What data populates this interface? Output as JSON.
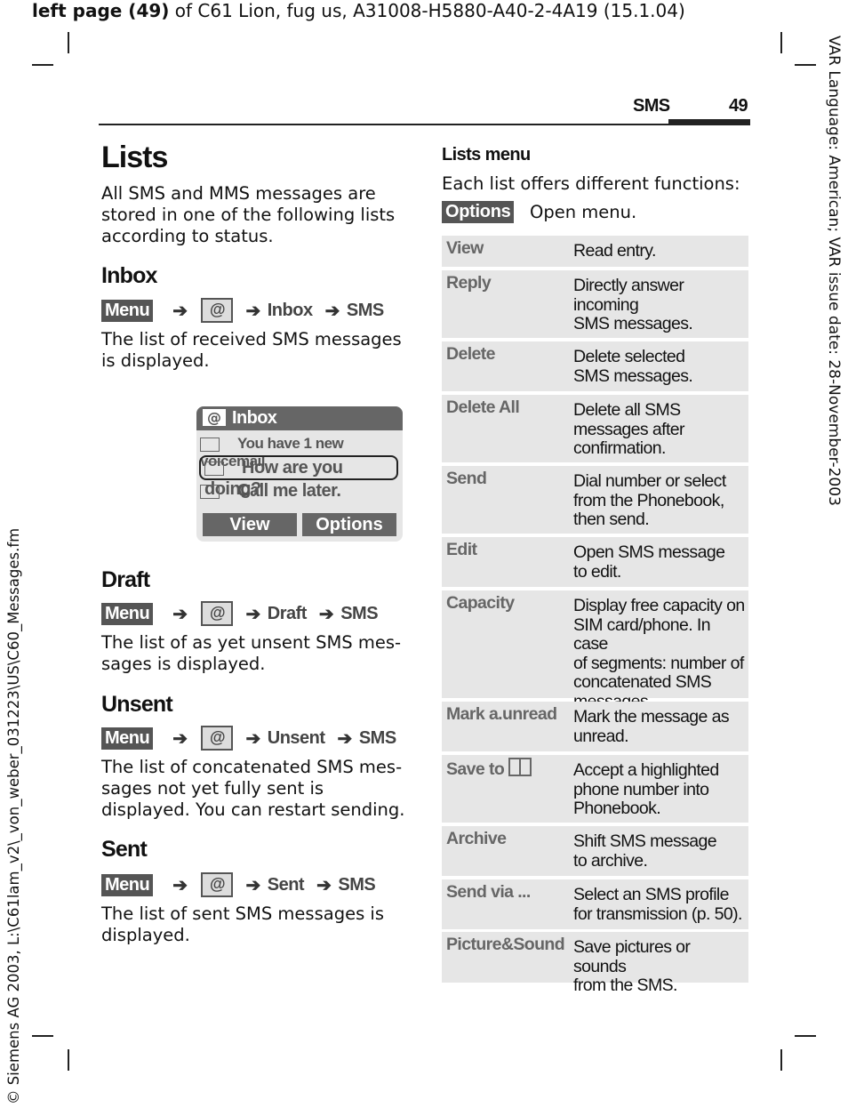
{
  "header": {
    "bold": "left page (49)",
    "rest": " of C61 Lion, fug us, A31008-H5880-A40-2-4A19 (15.1.04)"
  },
  "running_head": {
    "section": "SMS",
    "page": "49"
  },
  "side_right": "VAR Language: American; VAR issue date: 28-November-2003",
  "side_left": "© Siemens AG 2003, L:\\C61lam_v2\\_von_weber_031223\\US\\C60_Messages.fm",
  "title": "Lists",
  "intro": "All SMS and MMS messages are stored in one of the following lists according to status.",
  "menu_key": "Menu",
  "at_icon": "@",
  "arrow": "➔",
  "sections": [
    {
      "heading": "Inbox",
      "path": [
        "Inbox",
        "SMS"
      ],
      "text": "The list of received SMS messages is displayed."
    },
    {
      "heading": "Draft",
      "path": [
        "Draft",
        "SMS"
      ],
      "text": "The list of as yet unsent SMS mes-sages is displayed."
    },
    {
      "heading": "Unsent",
      "path": [
        "Unsent",
        "SMS"
      ],
      "text": "The list of concatenated SMS mes-sages not yet fully sent is displayed. You can restart sending."
    },
    {
      "heading": "Sent",
      "path": [
        "Sent",
        "SMS"
      ],
      "text": "The list of sent SMS messages is displayed."
    }
  ],
  "phone": {
    "title": "Inbox",
    "items": [
      "You have 1 new voicemail",
      "How are you doing?",
      "Call me later."
    ],
    "selected_index": 1,
    "softkeys": [
      "View",
      "Options"
    ]
  },
  "lists_menu": {
    "heading": "Lists menu",
    "text": "Each list offers different functions:",
    "options_key": "Options",
    "options_text": "Open menu.",
    "rows": [
      {
        "label": "View",
        "desc": "Read entry."
      },
      {
        "label": "Reply",
        "desc": "Directly answer\nincoming\nSMS messages."
      },
      {
        "label": "Delete",
        "desc": "Delete selected\nSMS messages."
      },
      {
        "label": "Delete All",
        "desc": "Delete all SMS\nmessages after\nconfirmation."
      },
      {
        "label": "Send",
        "desc": "Dial number or select\nfrom the Phonebook,\nthen send."
      },
      {
        "label": "Edit",
        "desc": "Open SMS message\nto edit."
      },
      {
        "label": "Capacity",
        "desc": "Display free capacity on\nSIM card/phone. In case\nof segments: number of\nconcatenated SMS\nmessages."
      },
      {
        "label": "Mark a.unread",
        "desc": "Mark the message as\nunread."
      },
      {
        "label": "Save to",
        "icon": "phonebook-icon",
        "desc": "Accept a highlighted\nphone number into\nPhonebook."
      },
      {
        "label": "Archive",
        "desc": "Shift SMS message\nto archive."
      },
      {
        "label": "Send via ...",
        "desc": "Select an SMS profile\nfor transmission (p. 50)."
      },
      {
        "label": "Picture&Sound",
        "desc": "Save pictures or sounds\nfrom the SMS."
      }
    ]
  }
}
